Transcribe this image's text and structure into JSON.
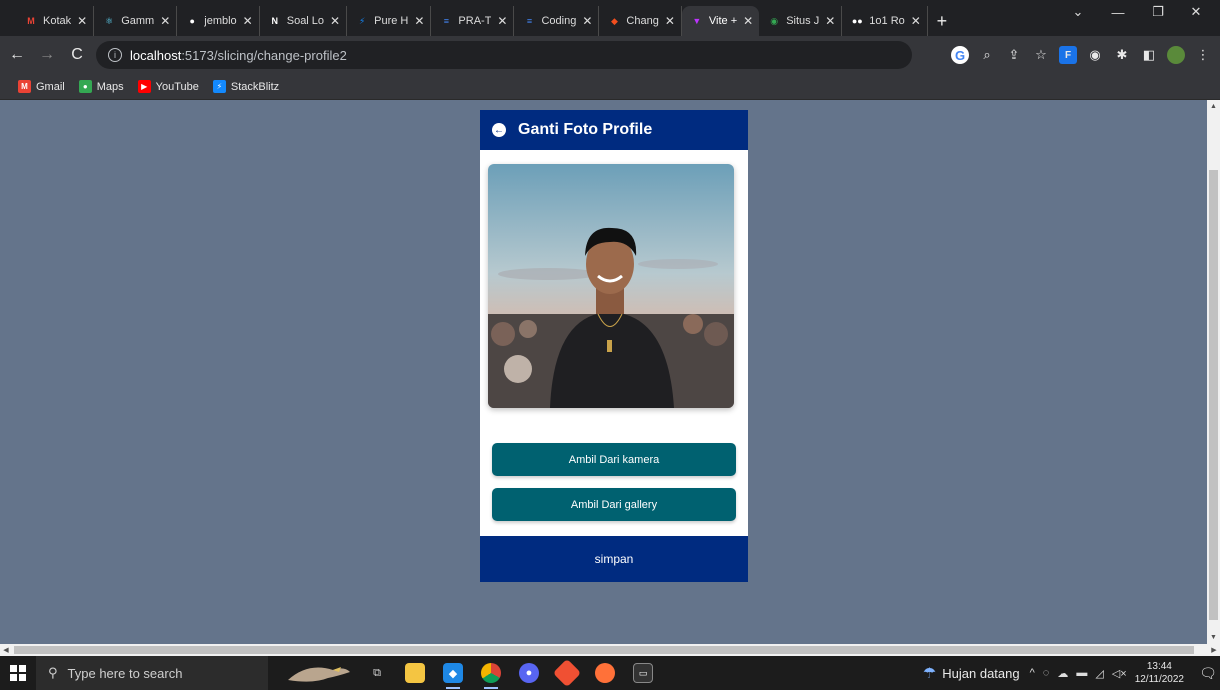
{
  "browser": {
    "tabs": [
      {
        "label": "Kotak",
        "icon": "gmail-icon",
        "color": "#ea4335",
        "glyph": "M"
      },
      {
        "label": "Gamm",
        "icon": "react-icon",
        "color": "#61dafb",
        "glyph": "⚛"
      },
      {
        "label": "jemblo",
        "icon": "github-icon",
        "color": "#ffffff",
        "glyph": "●"
      },
      {
        "label": "Soal Lo",
        "icon": "notion-icon",
        "color": "#ffffff",
        "glyph": "N"
      },
      {
        "label": "Pure H",
        "icon": "stackblitz-icon",
        "color": "#1389fd",
        "glyph": "⚡"
      },
      {
        "label": "PRA-T",
        "icon": "docs-icon",
        "color": "#4285f4",
        "glyph": "≡"
      },
      {
        "label": "Coding",
        "icon": "docs-icon",
        "color": "#4285f4",
        "glyph": "≡"
      },
      {
        "label": "Chang",
        "icon": "figma-icon",
        "color": "#f24e1e",
        "glyph": "◆"
      },
      {
        "label": "Vite +",
        "icon": "vite-icon",
        "color": "#bd34fe",
        "glyph": "▼",
        "active": true
      },
      {
        "label": "Situs J",
        "icon": "situs-icon",
        "color": "#34a853",
        "glyph": "◉"
      },
      {
        "label": "1o1 Ro",
        "icon": "dots-icon",
        "color": "#ffffff",
        "glyph": "●●"
      }
    ],
    "address": {
      "host": "localhost",
      "path": ":5173/slicing/change-profile2"
    },
    "bookmarks": [
      {
        "label": "Gmail",
        "icon": "gmail-icon",
        "color": "#ea4335",
        "glyph": "M"
      },
      {
        "label": "Maps",
        "icon": "maps-icon",
        "color": "#34a853",
        "glyph": "●"
      },
      {
        "label": "YouTube",
        "icon": "youtube-icon",
        "color": "#ff0000",
        "glyph": "▶"
      },
      {
        "label": "StackBlitz",
        "icon": "stackblitz-icon",
        "color": "#1389fd",
        "glyph": "⚡"
      }
    ]
  },
  "app": {
    "header_title": "Ganti Foto Profile",
    "btn_camera": "Ambil Dari kamera",
    "btn_gallery": "Ambil Dari gallery",
    "save_label": "simpan",
    "colors": {
      "header": "#002b80",
      "button": "#006170",
      "page_bg": "#64748b"
    }
  },
  "taskbar": {
    "search_placeholder": "Type here to search",
    "weather_text": "Hujan datang",
    "time": "13:44",
    "date": "12/11/2022"
  }
}
